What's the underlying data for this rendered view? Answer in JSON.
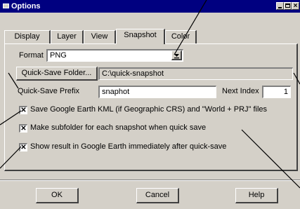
{
  "window": {
    "title": "Options"
  },
  "tabs": [
    "Display",
    "Layer",
    "View",
    "Snapshot",
    "Color"
  ],
  "format": {
    "label": "Format",
    "value": "PNG"
  },
  "quick_save": {
    "folder_button": "Quick-Save Folder...",
    "folder_path": "C:\\quick-snapshot",
    "prefix_label": "Quick-Save Prefix",
    "prefix_value": "snaphot",
    "next_index_label": "Next Index",
    "next_index_value": "1"
  },
  "options": [
    {
      "label": "Save Google Earth KML (if Geographic CRS) and \"World + PRJ\" files",
      "checked": true
    },
    {
      "label": "Make subfolder for each snapshot when quick save",
      "checked": true
    },
    {
      "label": "Show result in Google Earth immediately after quick-save",
      "checked": true
    }
  ],
  "buttons": {
    "ok": "OK",
    "cancel": "Cancel",
    "help": "Help"
  },
  "icons": {
    "close": "close-icon",
    "minimize": "minimize-icon",
    "maximize": "maximize-icon",
    "dropdown": "chevron-down-icon",
    "check": "checkmark-icon"
  },
  "colors": {
    "titlebar": "#000080",
    "face": "#d4d0c8"
  }
}
